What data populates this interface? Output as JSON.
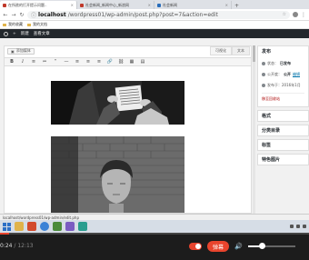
{
  "browser": {
    "tabs": [
      {
        "title": "在所欲的打开提示问题..",
        "active": true,
        "fav": "red"
      },
      {
        "title": "社会新闻_新闻中心_新浪网",
        "active": false,
        "fav": "red"
      },
      {
        "title": "社会新闻",
        "active": false,
        "fav": "blue"
      }
    ],
    "url_host": "localhost",
    "url_path": "/wordpress01/wp-admin/post.php?post=7&action=edit",
    "bookmarks": [
      "我的收藏",
      "我的文档"
    ]
  },
  "adminbar": {
    "site": "新建",
    "item2": "查看文章"
  },
  "editor": {
    "add_media": "添加媒体",
    "tab_visual": "可视化",
    "tab_text": "文本",
    "toolbar": [
      "B",
      "I",
      "≡",
      "≔",
      "“",
      "—",
      "≡",
      "≡",
      "≡",
      "🔗",
      "⛓",
      "▦",
      "▤"
    ]
  },
  "sidebar": {
    "publish_title": "发布",
    "status_label": "状态：",
    "status_value": "已发布",
    "visibility_label": "公开度：",
    "visibility_value": "公开",
    "visibility_link": "编辑",
    "date_label": "发布于：2016年1月",
    "trash": "移至回收站",
    "boxes": [
      "格式",
      "分类目录",
      "标签",
      "特色图片"
    ]
  },
  "statusbar": {
    "text": "localhost/wordpress01/wp-admin/edit.php"
  },
  "player": {
    "current_time": "0:24",
    "total_time": "/ 12:13",
    "danmu_label": "弹幕",
    "progress": 0.03,
    "volume": 0.3
  }
}
